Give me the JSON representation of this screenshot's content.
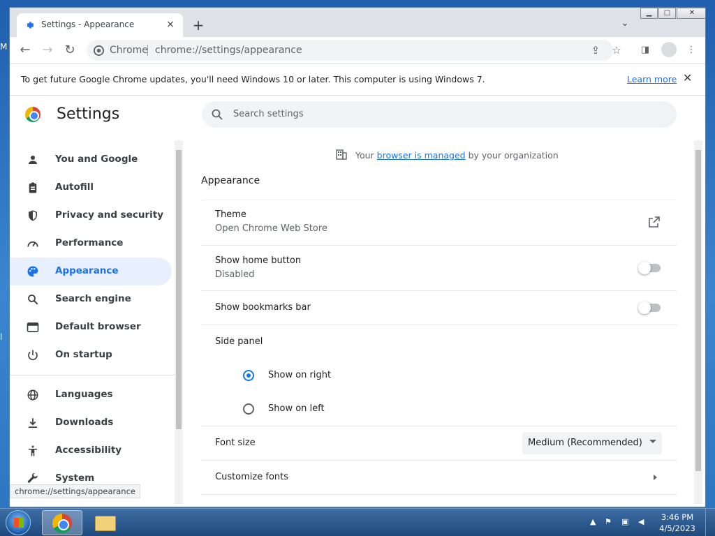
{
  "desktop": {
    "edge_letter_1": "M",
    "edge_letter_2": "l"
  },
  "browser": {
    "tab": {
      "title": "Settings - Appearance",
      "close": "×"
    },
    "new_tab": "+",
    "tab_search": "⌄",
    "window_controls": {
      "minimize": "▁",
      "maximize": "□",
      "close": "✕"
    },
    "toolbar": {
      "back": "←",
      "forward": "→",
      "reload": "↻",
      "site_label": "Chrome",
      "url": "chrome://settings/appearance"
    }
  },
  "infobar": {
    "message": "To get future Google Chrome updates, you'll need Windows 10 or later. This computer is using Windows 7.",
    "link": "Learn more",
    "close": "✕"
  },
  "settings": {
    "title": "Settings",
    "search_placeholder": "Search settings",
    "sidebar": [
      {
        "label": "You and Google",
        "icon": "person-icon"
      },
      {
        "label": "Autofill",
        "icon": "clipboard-icon"
      },
      {
        "label": "Privacy and security",
        "icon": "shield-icon"
      },
      {
        "label": "Performance",
        "icon": "speedometer-icon"
      },
      {
        "label": "Appearance",
        "icon": "palette-icon",
        "active": true
      },
      {
        "label": "Search engine",
        "icon": "search-icon"
      },
      {
        "label": "Default browser",
        "icon": "browser-icon"
      },
      {
        "label": "On startup",
        "icon": "power-icon"
      },
      {
        "label": "Languages",
        "icon": "globe-icon"
      },
      {
        "label": "Downloads",
        "icon": "download-icon"
      },
      {
        "label": "Accessibility",
        "icon": "accessibility-icon"
      },
      {
        "label": "System",
        "icon": "wrench-icon"
      }
    ],
    "status_url": "chrome://settings/appearance",
    "managed": {
      "prefix": "Your",
      "link": "browser is managed",
      "suffix": "by your organization"
    },
    "section_title": "Appearance",
    "rows": {
      "theme": {
        "title": "Theme",
        "sub": "Open Chrome Web Store"
      },
      "home_button": {
        "title": "Show home button",
        "sub": "Disabled",
        "enabled": false
      },
      "bookmarks_bar": {
        "title": "Show bookmarks bar",
        "enabled": false
      },
      "side_panel": {
        "title": "Side panel",
        "options": [
          "Show on right",
          "Show on left"
        ],
        "selected": "Show on right"
      },
      "font_size": {
        "title": "Font size",
        "value": "Medium (Recommended)"
      },
      "customize_fonts": {
        "title": "Customize fonts"
      }
    }
  },
  "taskbar": {
    "clock_time": "3:46 PM",
    "clock_date": "4/5/2023",
    "tray_expand": "▲"
  },
  "colors": {
    "accent": "#1a73e8",
    "active_bg": "#e8f0fe"
  }
}
